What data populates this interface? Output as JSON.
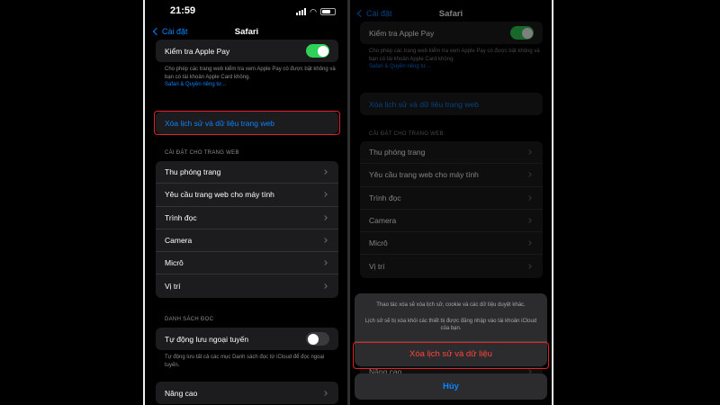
{
  "left": {
    "status_time": "21:59",
    "nav": {
      "back_label": "Cài đặt",
      "title": "Safari"
    },
    "apple_pay": {
      "label": "Kiểm tra Apple Pay",
      "enabled": true,
      "note": "Cho phép các trang web kiểm tra xem Apple Pay có được bật không và bạn có tài khoản Apple Card không.",
      "link": "Safari & Quyền riêng tư..."
    },
    "clear_history": "Xóa lịch sử và dữ liệu trang web",
    "website_settings_header": "CÀI ĐẶT CHO TRANG WEB",
    "website_settings": [
      "Thu phóng trang",
      "Yêu cầu trang web cho máy tính",
      "Trình đọc",
      "Camera",
      "Micrô",
      "Vị trí"
    ],
    "reading_list_header": "DANH SÁCH ĐỌC",
    "offline": {
      "label": "Tự động lưu ngoại tuyến",
      "enabled": false,
      "note": "Tự động lưu tất cả các mục Danh sách đọc từ iCloud để đọc ngoại tuyến."
    },
    "advanced": "Nâng cao"
  },
  "right": {
    "nav": {
      "back_label": "Cài đặt",
      "title": "Safari"
    },
    "apple_pay": {
      "label": "Kiểm tra Apple Pay",
      "enabled": true,
      "note": "Cho phép các trang web kiểm tra xem Apple Pay có được bật không và bạn có tài khoản Apple Card không.",
      "link": "Safari & Quyền riêng tư..."
    },
    "clear_history": "Xóa lịch sử và dữ liệu trang web",
    "website_settings_header": "CÀI ĐẶT CHO TRANG WEB",
    "website_settings": [
      "Thu phóng trang",
      "Yêu cầu trang web cho máy tính",
      "Trình đọc",
      "Camera",
      "Micrô",
      "Vị trí"
    ],
    "advanced": "Nâng cao",
    "sheet": {
      "message1": "Thao tác xóa sẽ xóa lịch sử, cookie và các dữ liệu duyệt khác.",
      "message2": "Lịch sử sẽ bị xóa khỏi các thiết bị được đăng nhập vào tài khoản iCloud của bạn.",
      "destructive": "Xóa lịch sử và dữ liệu",
      "cancel": "Hủy"
    }
  },
  "colors": {
    "accent": "#0a84ff",
    "toggle_on": "#30d158",
    "destructive": "#ff453a",
    "highlight": "#e0242a"
  }
}
